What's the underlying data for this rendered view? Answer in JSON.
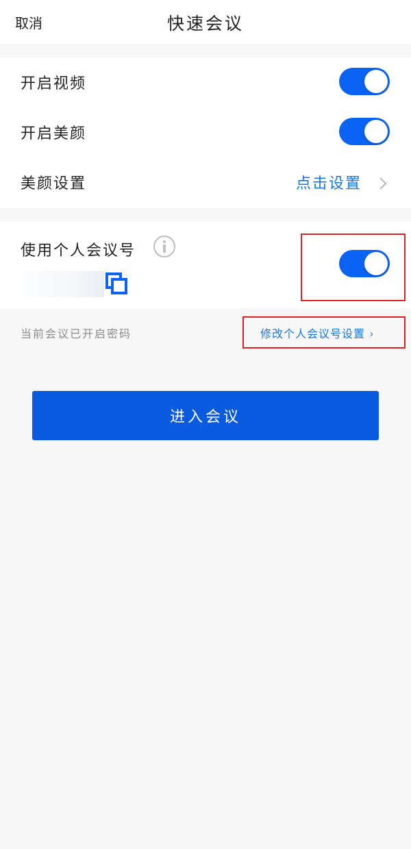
{
  "header": {
    "cancel_label": "取消",
    "title": "快速会议"
  },
  "settings": {
    "video_label": "开启视频",
    "video_on": true,
    "beauty_label": "开启美颜",
    "beauty_on": true,
    "beauty_settings_label": "美颜设置",
    "beauty_settings_action": "点击设置"
  },
  "personal_meeting": {
    "label": "使用个人会议号",
    "enabled": true,
    "info_icon": "info-circle-icon",
    "copy_icon": "copy-icon"
  },
  "footer": {
    "password_hint": "当前会议已开启密码",
    "modify_link": "修改个人会议号设置 ›"
  },
  "enter_button_label": "进入会议",
  "colors": {
    "accent": "#0a63f3",
    "link": "#1677e8",
    "highlight_box": "#e02020",
    "background": "#f7f7f7"
  }
}
